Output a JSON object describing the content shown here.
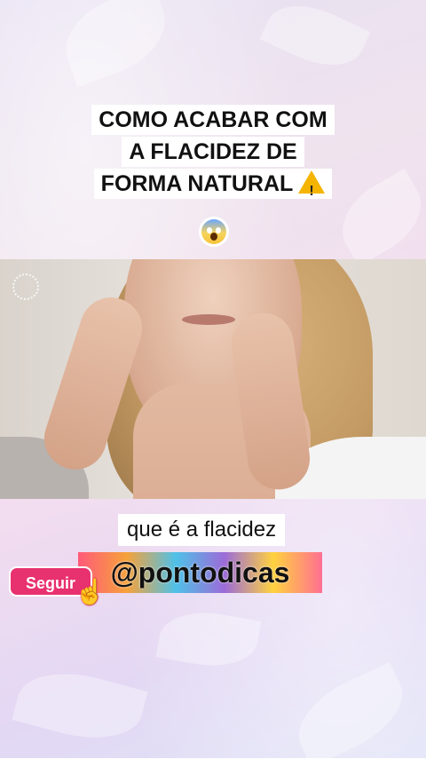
{
  "title": {
    "line1": "COMO ACABAR COM",
    "line2": "A FLACIDEZ DE",
    "line3": "FORMA NATURAL",
    "warning_icon": "warning-icon",
    "emoji_icon": "scared-face-emoji"
  },
  "caption": "que é a flacidez",
  "handle": "@pontodicas",
  "follow_button": {
    "label": "Seguir",
    "icon": "hand-pointer-icon"
  },
  "colors": {
    "follow": "#e8316f",
    "warning": "#f4b400"
  }
}
